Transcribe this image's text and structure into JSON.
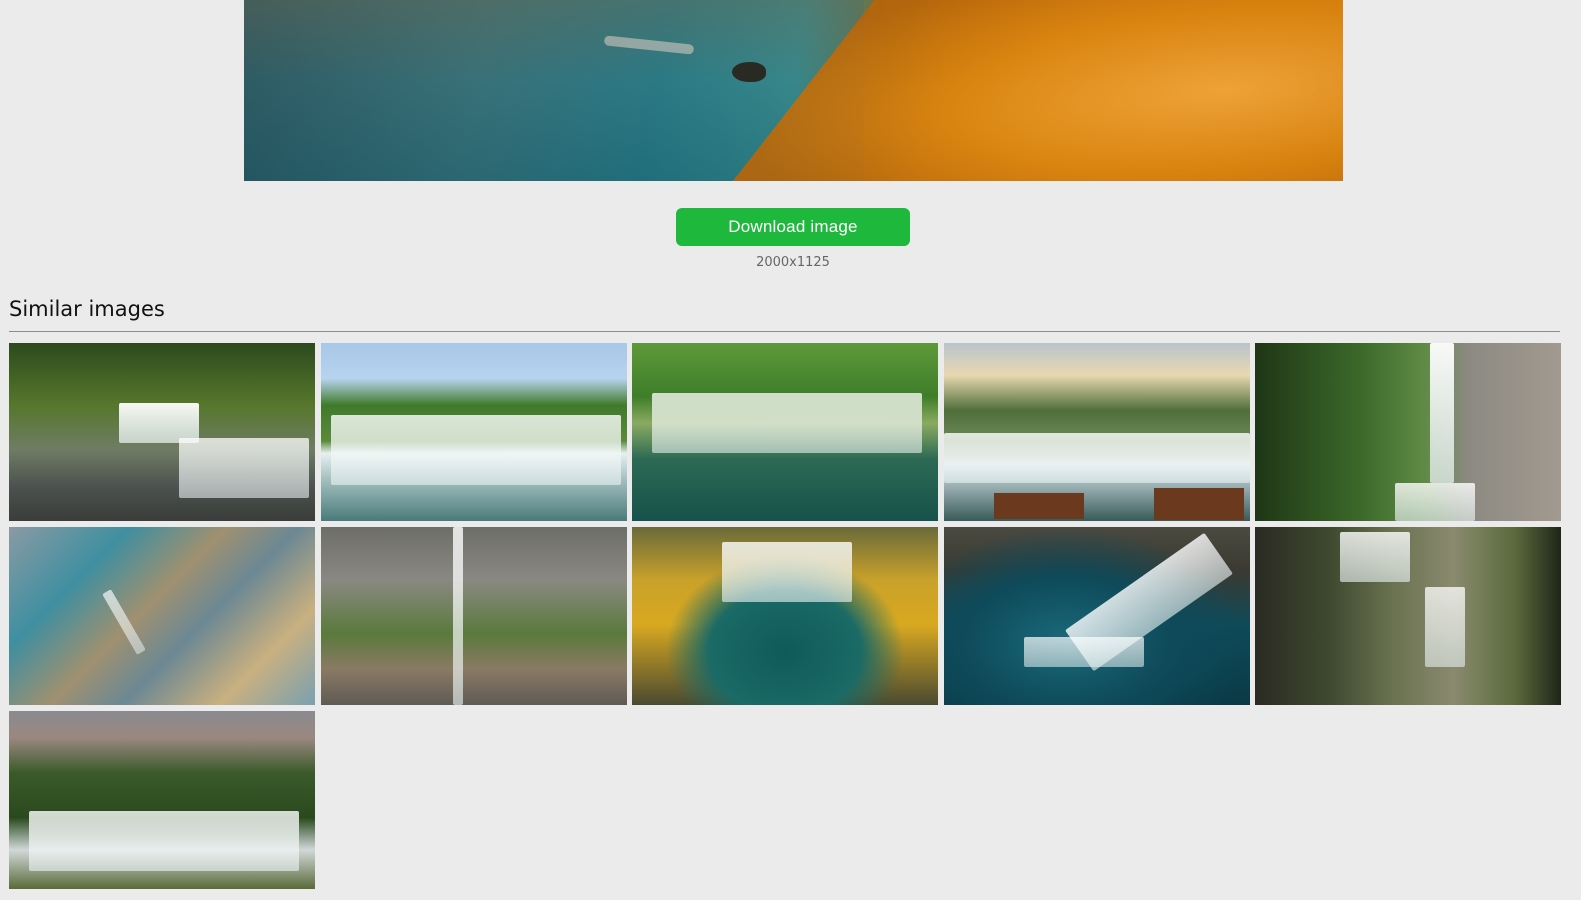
{
  "hero": {
    "alt": "Lake shore with autumn leaves"
  },
  "download": {
    "button_label": "Download image",
    "dimensions": "2000x1125",
    "accent_color": "#1db83c"
  },
  "similar": {
    "title": "Similar images",
    "thumbnails": [
      {
        "alt": "Forest waterfall cascade"
      },
      {
        "alt": "Wide waterfall under trees"
      },
      {
        "alt": "Mossy cascading waterfall"
      },
      {
        "alt": "Waterfall at sunset with chairs"
      },
      {
        "alt": "Tall waterfall beside cliff"
      },
      {
        "alt": "Aerial view of blue stream"
      },
      {
        "alt": "Thin waterfall down rock face"
      },
      {
        "alt": "Autumn waterfall aerial view"
      },
      {
        "alt": "Waterfall into turquoise pool"
      },
      {
        "alt": "Forest stream with hiker"
      },
      {
        "alt": "Waterfall under cloudy sky"
      }
    ]
  }
}
